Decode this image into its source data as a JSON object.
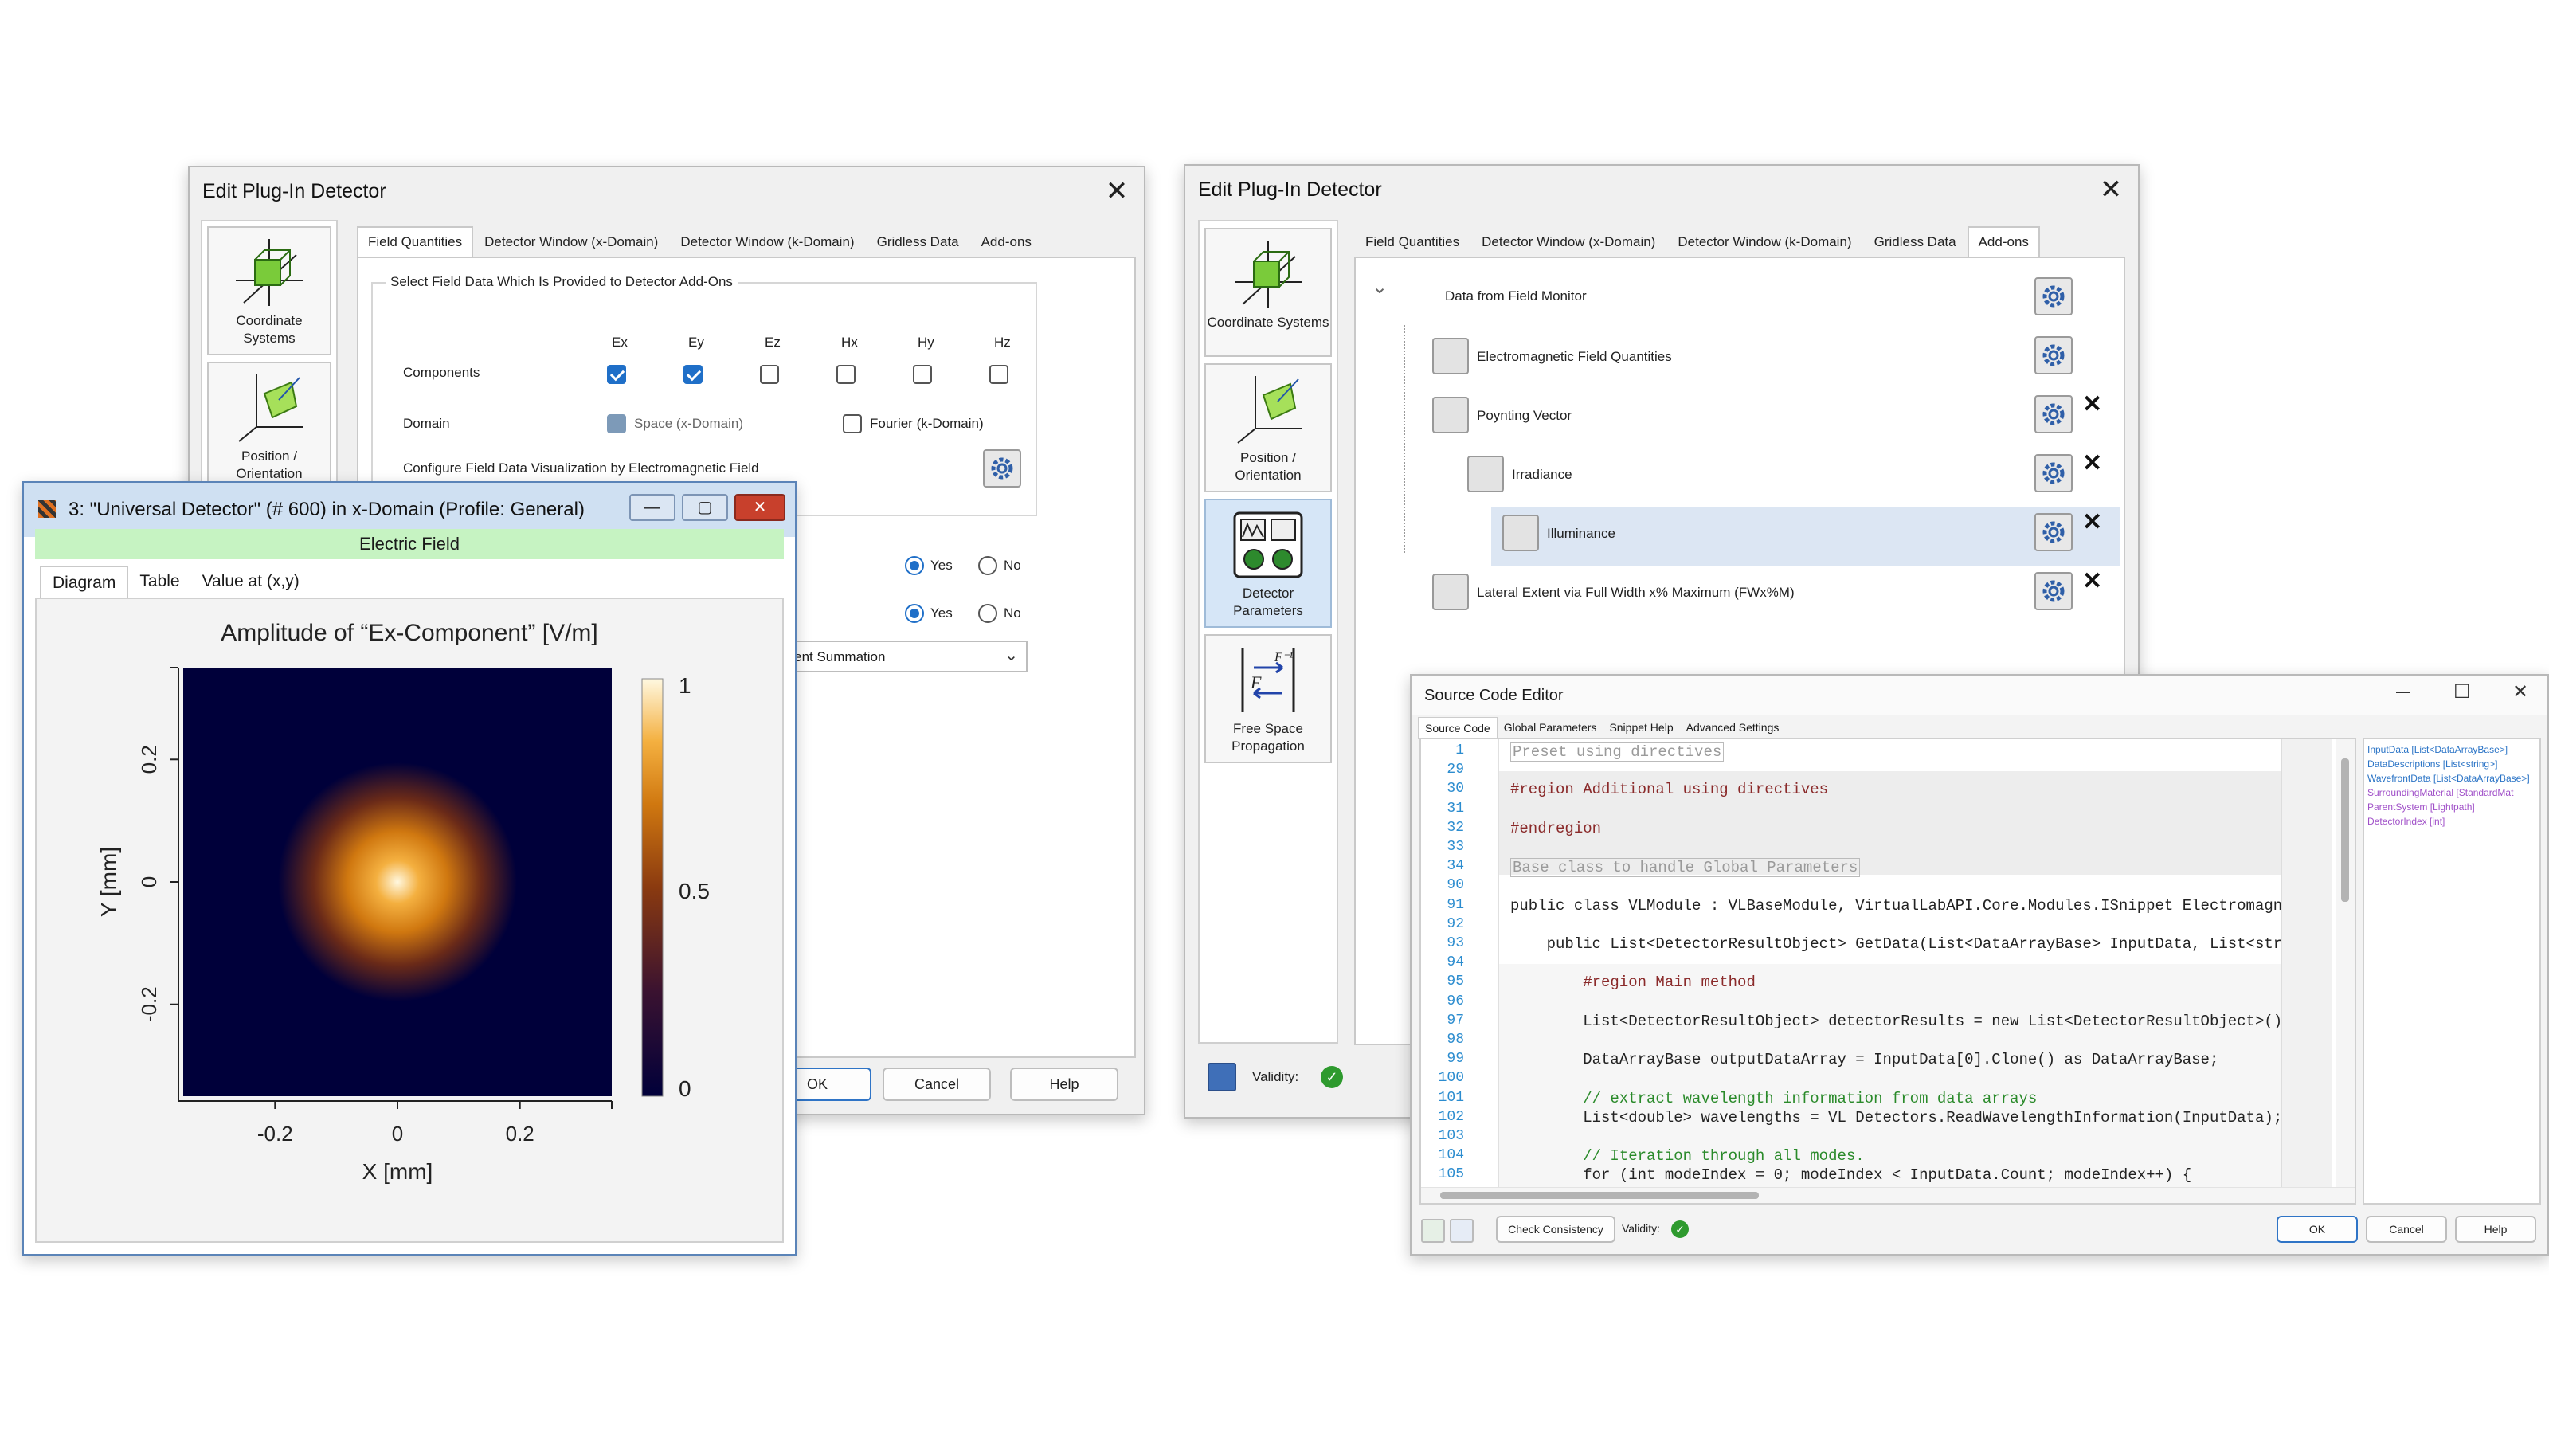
{
  "left_dialog": {
    "title": "Edit Plug-In Detector",
    "sidebar": [
      "Coordinate Systems",
      "Position / Orientation"
    ],
    "tabs": [
      "Field Quantities",
      "Detector Window (x-Domain)",
      "Detector Window (k-Domain)",
      "Gridless Data",
      "Add-ons"
    ],
    "group_title": "Select Field Data Which Is Provided to Detector Add-Ons",
    "components_label": "Components",
    "component_headers": [
      "Ex",
      "Ey",
      "Ez",
      "Hx",
      "Hy",
      "Hz"
    ],
    "component_checked": [
      true,
      true,
      false,
      false,
      false,
      false
    ],
    "domain_label": "Domain",
    "domain_space": "Space (x-Domain)",
    "domain_fourier": "Fourier (k-Domain)",
    "configure_label": "Configure Field Data Visualization by Electromagnetic Field",
    "yes": "Yes",
    "no": "No",
    "dropdown_text": "erent Summation",
    "ok": "OK",
    "cancel": "Cancel",
    "help": "Help"
  },
  "plot_window": {
    "title": "3: \"Universal Detector\" (# 600) in x-Domain (Profile: General)",
    "banner": "Electric Field",
    "tabs": [
      "Diagram",
      "Table",
      "Value at (x,y)"
    ],
    "window_buttons": {
      "minimize": "—",
      "maximize": "▢",
      "close": "✕"
    }
  },
  "chart_data": {
    "type": "heatmap",
    "title": "Amplitude of “Ex-Component”  [V/m]",
    "xlabel": "X [mm]",
    "ylabel": "Y [mm]",
    "x_ticks": [
      "-0.2",
      "0",
      "0.2"
    ],
    "y_ticks": [
      "0.2",
      "0",
      "-0.2"
    ],
    "xlim": [
      -0.35,
      0.35
    ],
    "ylim": [
      -0.35,
      0.35
    ],
    "colorbar_ticks": [
      "1",
      "0.5",
      "0"
    ],
    "colorbar_range": [
      0,
      1
    ],
    "colormap": [
      "#00003a",
      "#3a1230",
      "#8a3a10",
      "#d07810",
      "#f4b040",
      "#fff8e0"
    ],
    "peak": {
      "x": 0,
      "y": 0,
      "value": 1
    },
    "description": "Gaussian spot centered at (0,0)"
  },
  "right_dialog": {
    "title": "Edit Plug-In Detector",
    "sidebar": [
      "Coordinate Systems",
      "Position / Orientation",
      "Detector Parameters",
      "Free Space Propagation"
    ],
    "tabs": [
      "Field Quantities",
      "Detector Window (x-Domain)",
      "Detector Window (k-Domain)",
      "Gridless Data",
      "Add-ons"
    ],
    "tree": [
      "Data from Field Monitor",
      "Electromagnetic Field Quantities",
      "Poynting Vector",
      "Irradiance",
      "Illuminance",
      "Lateral Extent via Full Width x% Maximum (FWx%M)"
    ],
    "validity": "Validity:"
  },
  "source_editor": {
    "title": "Source Code Editor",
    "window_buttons": {
      "minimize": "—",
      "maximize": "☐",
      "close": "✕"
    },
    "tabs": [
      "Source Code",
      "Global Parameters",
      "Snippet Help",
      "Advanced Settings"
    ],
    "line_numbers": [
      "1",
      "29",
      "30",
      "31",
      "32",
      "33",
      "34",
      "90",
      "91",
      "92",
      "93",
      "94",
      "95",
      "96",
      "97",
      "98",
      "99",
      "100",
      "101",
      "102",
      "103",
      "104",
      "105"
    ],
    "lines": [
      "Preset using directives",
      "",
      "#region Additional using directives",
      "",
      "#endregion",
      "",
      "Base class to handle Global Parameters",
      "",
      "public class VLModule : VLBaseModule, VirtualLabAPI.Core.Modules.ISnippet_Electromagne",
      "",
      "    public List<DetectorResultObject> GetData(List<DataArrayBase> InputData, List<stri",
      "",
      "        #region Main method",
      "",
      "        List<DetectorResultObject> detectorResults = new List<DetectorResultObject>()",
      "",
      "        DataArrayBase outputDataArray = InputData[0].Clone() as DataArrayBase;",
      "",
      "        // extract wavelength information from data arrays",
      "        List<double> wavelengths = VL_Detectors.ReadWavelengthInformation(InputData);",
      "",
      "        // Iteration through all modes.",
      "        for (int modeIndex = 0; modeIndex < InputData.Count; modeIndex++) {"
    ],
    "side_list": [
      "InputData [List<DataArrayBase>]",
      "DataDescriptions [List<string>]",
      "WavefrontData [List<DataArrayBase>]",
      "SurroundingMaterial [StandardMat",
      "ParentSystem [Lightpath]",
      "DetectorIndex [int]"
    ],
    "check_consistency": "Check Consistency",
    "validity": "Validity:",
    "ok": "OK",
    "cancel": "Cancel",
    "help": "Help"
  }
}
